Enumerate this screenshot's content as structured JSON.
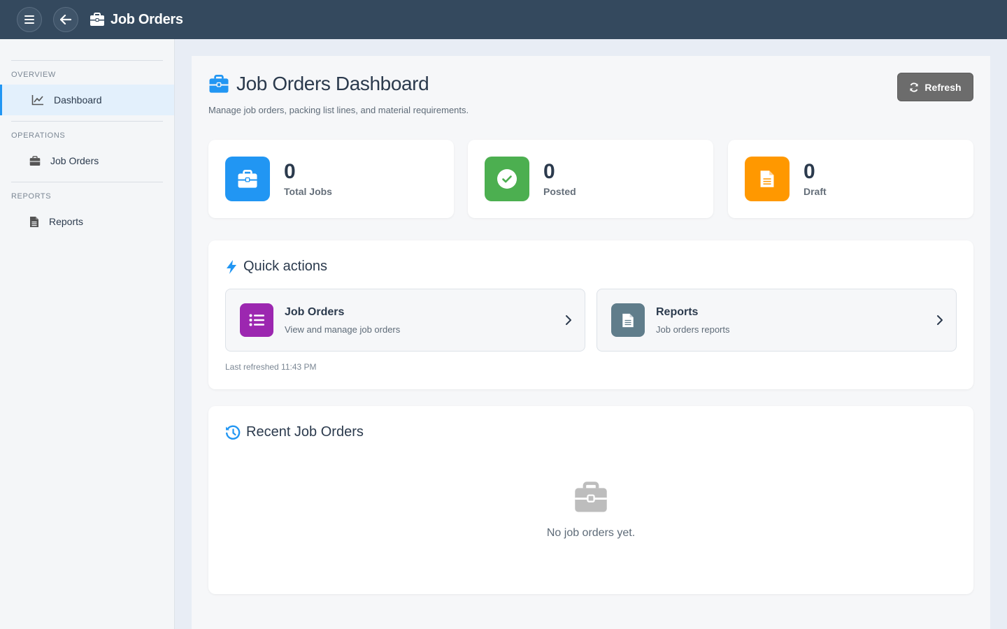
{
  "topbar": {
    "title": "Job Orders",
    "icons": {
      "menu": "hamburger-icon",
      "back": "arrow-left-icon",
      "title": "briefcase-icon"
    }
  },
  "sidebar": {
    "sections": [
      {
        "label": "OVERVIEW",
        "items": [
          {
            "label": "Dashboard",
            "icon": "chart-line-icon",
            "active": true
          }
        ]
      },
      {
        "label": "OPERATIONS",
        "items": [
          {
            "label": "Job Orders",
            "icon": "briefcase-icon",
            "active": false
          }
        ]
      },
      {
        "label": "REPORTS",
        "items": [
          {
            "label": "Reports",
            "icon": "file-icon",
            "active": false
          }
        ]
      }
    ]
  },
  "header": {
    "title": "Job Orders Dashboard",
    "subtitle": "Manage job orders, packing list lines, and material requirements.",
    "refresh_label": "Refresh"
  },
  "stats": [
    {
      "value": "0",
      "label": "Total Jobs",
      "color": "#2196f3",
      "icon": "briefcase-icon"
    },
    {
      "value": "0",
      "label": "Posted",
      "color": "#4caf50",
      "icon": "check-circle-icon"
    },
    {
      "value": "0",
      "label": "Draft",
      "color": "#ff9800",
      "icon": "file-icon"
    }
  ],
  "quick_actions": {
    "title": "Quick actions",
    "items": [
      {
        "title": "Job Orders",
        "description": "View and manage job orders",
        "color": "#9c27b0",
        "icon": "list-icon"
      },
      {
        "title": "Reports",
        "description": "Job orders reports",
        "color": "#607d8b",
        "icon": "file-icon"
      }
    ],
    "last_refreshed": "Last refreshed 11:43 PM"
  },
  "recent": {
    "title": "Recent Job Orders",
    "empty_text": "No job orders yet."
  }
}
